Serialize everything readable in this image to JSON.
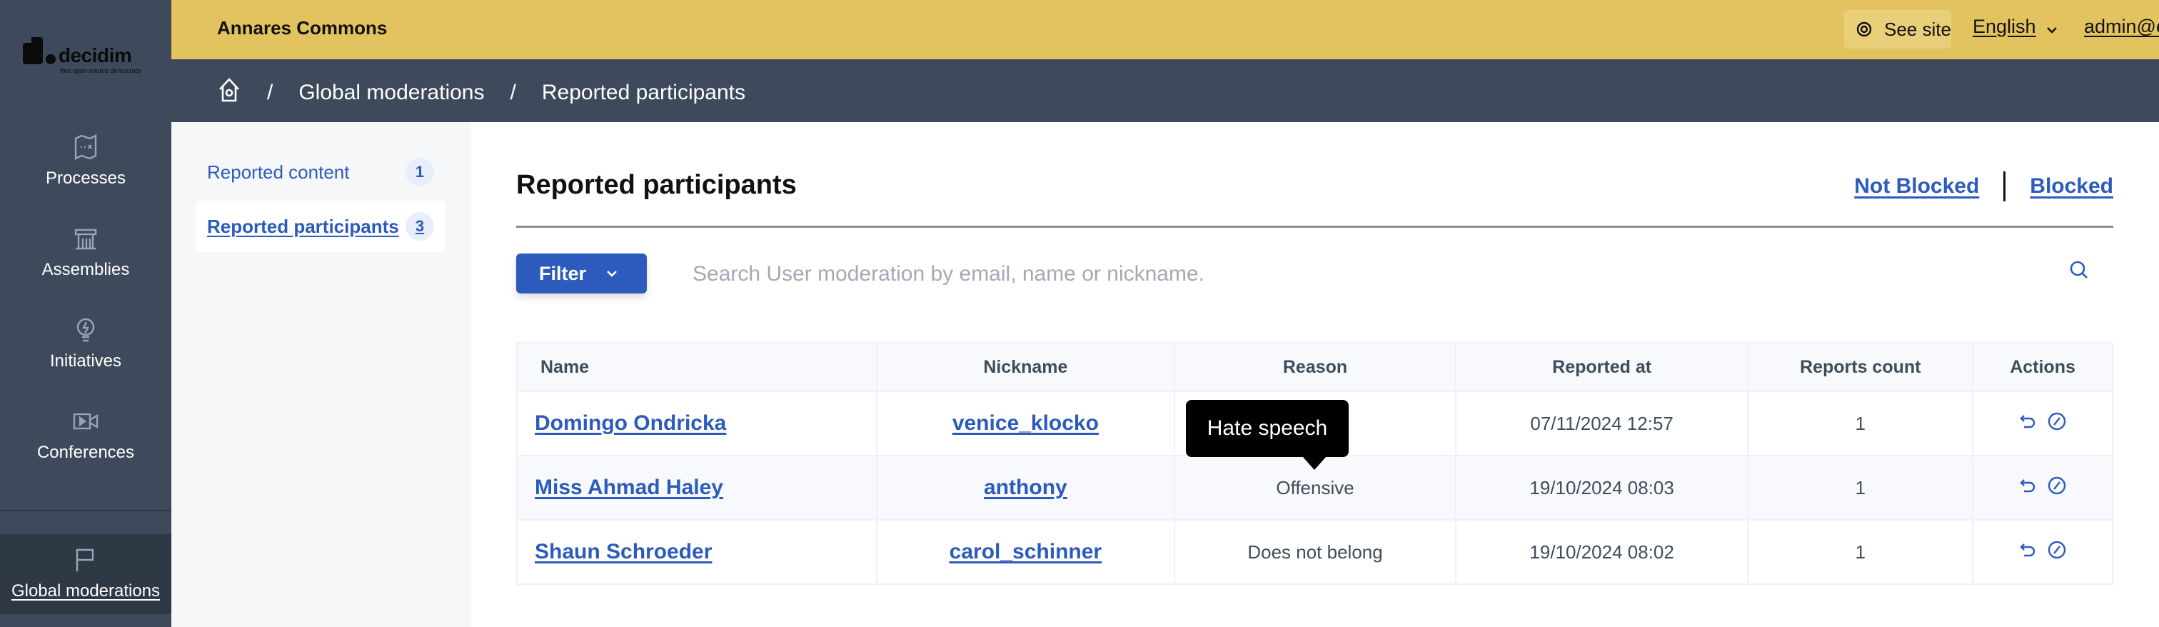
{
  "sidebar": {
    "logo": {
      "word": "decidim",
      "tagline": "free open-source democracy"
    },
    "items": [
      {
        "label": "Processes",
        "icon": "map-icon"
      },
      {
        "label": "Assemblies",
        "icon": "building-icon"
      },
      {
        "label": "Initiatives",
        "icon": "lightbulb-icon"
      },
      {
        "label": "Conferences",
        "icon": "video-icon"
      },
      {
        "label": "Global moderations",
        "icon": "flag-icon",
        "active": true
      }
    ]
  },
  "topbar": {
    "org_name": "Annares Commons",
    "see_site": "See site",
    "language": "English",
    "user": "admin@example.org"
  },
  "breadcrumb": {
    "items": [
      "Global moderations",
      "Reported participants"
    ]
  },
  "subnav": {
    "items": [
      {
        "label": "Reported content",
        "count": "1"
      },
      {
        "label": "Reported participants",
        "count": "3",
        "active": true
      }
    ]
  },
  "main": {
    "title": "Reported participants",
    "tabs": {
      "not_blocked": "Not Blocked",
      "blocked": "Blocked"
    },
    "filter_label": "Filter",
    "search": {
      "placeholder": "Search User moderation by email, name or nickname.",
      "value": ""
    },
    "table": {
      "headers": [
        "Name",
        "Nickname",
        "Reason",
        "Reported at",
        "Reports count",
        "Actions"
      ],
      "rows": [
        {
          "name": "Domingo Ondricka",
          "nickname": "venice_klocko",
          "reason": "",
          "reported_at": "07/11/2024 12:57",
          "count": "1"
        },
        {
          "name": "Miss Ahmad Haley",
          "nickname": "anthony",
          "reason": "Offensive",
          "reported_at": "19/10/2024 08:03",
          "count": "1"
        },
        {
          "name": "Shaun Schroeder",
          "nickname": "carol_schinner",
          "reason": "Does not belong",
          "reported_at": "19/10/2024 08:02",
          "count": "1"
        }
      ]
    },
    "tooltip": "Hate speech"
  },
  "colors": {
    "topbar": "#e3c35f",
    "sidebar": "#3e4a5c",
    "accent": "#2c5bbd"
  }
}
